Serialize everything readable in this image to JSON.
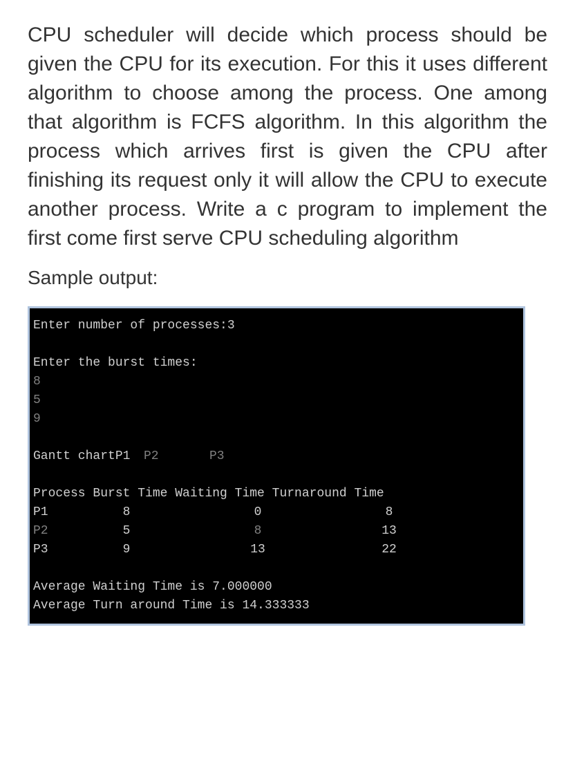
{
  "question": "CPU scheduler will decide which process should be given the CPU for its execution. For this it uses different algorithm to choose among the process. One among that algorithm is FCFS algorithm. In this algorithm the process which arrives first is given the CPU after finishing its request only it will allow the CPU to execute another process. Write a c program to implement the first come first serve CPU scheduling algorithm",
  "sample_label": "Sample output:",
  "terminal": {
    "line1": "Enter number of processes:3",
    "line2": "Enter the burst times:",
    "burst_inputs": [
      "8",
      "5",
      "9"
    ],
    "gantt_label": "Gantt chartP1",
    "gantt_p2": "P2",
    "gantt_p3": "P3",
    "header": "Process Burst Time Waiting Time Turnaround Time",
    "rows": [
      {
        "proc": "P1",
        "burst": "8",
        "wait": "0",
        "tat": "8"
      },
      {
        "proc": "P2",
        "burst": "5",
        "wait": "8",
        "tat": "13"
      },
      {
        "proc": "P3",
        "burst": "9",
        "wait": "13",
        "tat": "22"
      }
    ],
    "avg_wait": "Average Waiting Time is 7.000000",
    "avg_tat": "Average Turn around Time is 14.333333"
  }
}
